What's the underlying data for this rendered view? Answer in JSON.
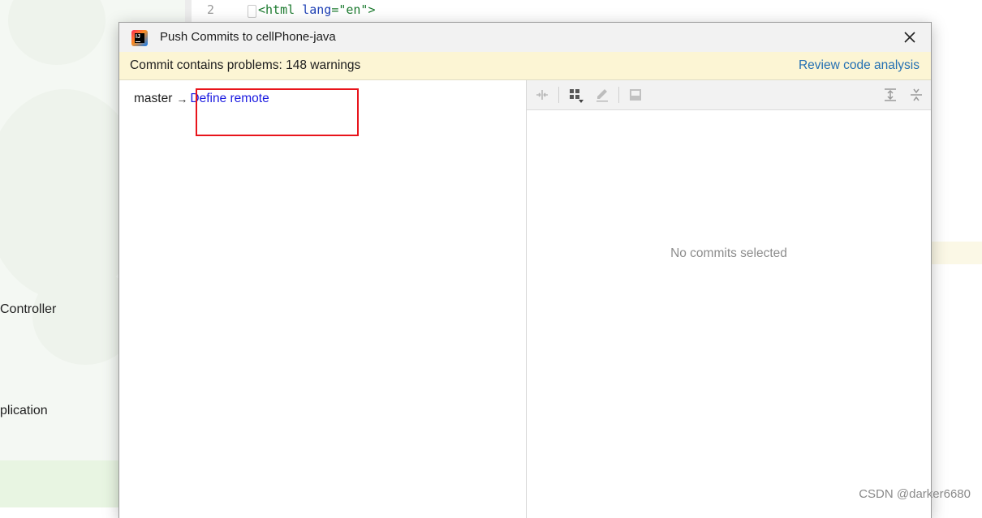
{
  "background": {
    "line_number": "2",
    "code": {
      "open": "<",
      "tag": "html",
      "attr": " lang",
      "eq": "=",
      "value": "\"en\"",
      "close": ">"
    },
    "sidebar_items": [
      {
        "label": "Controller"
      },
      {
        "label": "plication"
      }
    ],
    "watermark": "CSDN @darker6680"
  },
  "dialog": {
    "title": "Push Commits to cellPhone-java",
    "warning": {
      "message": "Commit contains problems: 148 warnings",
      "link_label": "Review code analysis"
    },
    "branch": {
      "name": "master",
      "arrow": "→",
      "remote_link": "Define remote"
    },
    "details": {
      "empty_message": "No commits selected"
    },
    "toolbar": [
      {
        "icon": "collapse-icon",
        "enabled": false
      },
      {
        "icon": "group-by-icon",
        "enabled": true
      },
      {
        "icon": "edit-icon",
        "enabled": false
      },
      {
        "icon": "preview-icon",
        "enabled": false
      },
      {
        "icon": "expand-all-icon",
        "enabled": true
      },
      {
        "icon": "collapse-all-icon",
        "enabled": true
      }
    ]
  },
  "colors": {
    "warning_bg": "#fcf5d4",
    "link": "#2470b3",
    "remote_link": "#1a1ae0",
    "annotation_box": "#e8141b"
  }
}
